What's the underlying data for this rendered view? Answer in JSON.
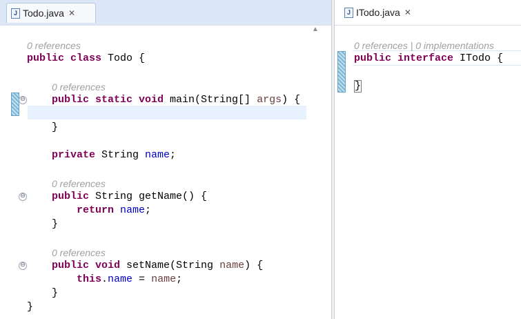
{
  "left_tab": {
    "icon": "J",
    "title": "Todo.java",
    "close": "✕"
  },
  "right_tab": {
    "icon": "J",
    "title": "ITodo.java",
    "close": "✕"
  },
  "left_code": {
    "ref1": "0 references",
    "l1_kw": "public class",
    "l1_rest": " Todo {",
    "ref2": "0 references",
    "l2_kw": "public static void",
    "l2_rest": " main(String[] ",
    "l2_par": "args",
    "l2_end": ") {",
    "l4": "}",
    "l5_kw": "private",
    "l5_rest": " String ",
    "l5_fld": "name",
    "l5_end": ";",
    "ref3": "0 references",
    "l6_kw": "public",
    "l6_rest": " String getName() {",
    "l7_kw": "return",
    "l7_fld": "name",
    "l7_end": ";",
    "l8": "}",
    "ref4": "0 references",
    "l9_kw": "public void",
    "l9_rest": " setName(String ",
    "l9_par": "name",
    "l9_end": ") {",
    "l10_kw": "this",
    "l10_dot": ".",
    "l10_fld": "name",
    "l10_eq": " = ",
    "l10_par": "name",
    "l10_end": ";",
    "l11": "}",
    "l12": "}"
  },
  "right_code": {
    "ref": "0 references | 0 implementations",
    "l1_kw": "public interface",
    "l1_rest": " ITodo {",
    "l2": "}"
  },
  "fold_symbol": "⊖",
  "scroll_up": "▲"
}
